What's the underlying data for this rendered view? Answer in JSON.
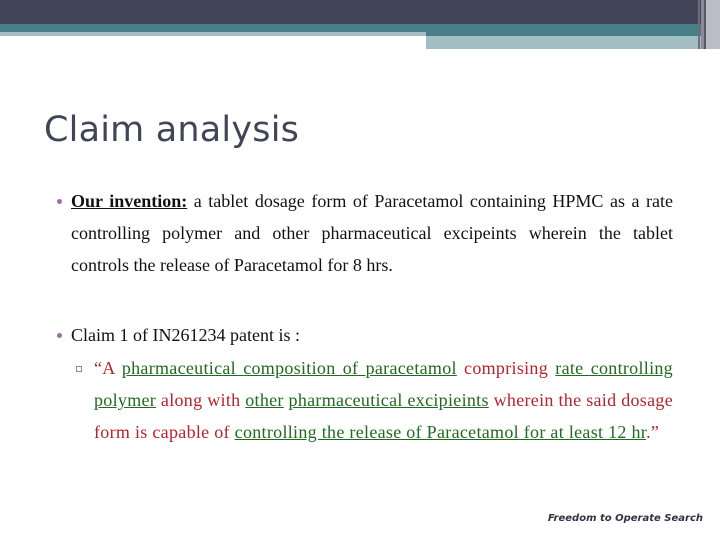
{
  "slide": {
    "title": "Claim analysis",
    "bullets": [
      {
        "label": "Our invention:",
        "text": " a tablet dosage form of Paracetamol containing HPMC as a rate controlling polymer and other pharmaceutical excipeints wherein the tablet controls the release of Paracetamol for 8 hrs."
      },
      {
        "text": "Claim 1 of IN261234 patent is :"
      }
    ],
    "claim_segments": [
      {
        "text": "“A ",
        "style": "red"
      },
      {
        "text": "pharmaceutical ",
        "style": "green"
      },
      {
        "text": " ",
        "style": "red"
      },
      {
        "text": "composition ",
        "style": "green"
      },
      {
        "text": " ",
        "style": "red"
      },
      {
        "text": "of ",
        "style": "green"
      },
      {
        "text": " ",
        "style": "red"
      },
      {
        "text": "paracetamol",
        "style": "green"
      },
      {
        "text": " comprising ",
        "style": "red"
      },
      {
        "text": "rate controlling ",
        "style": "green"
      },
      {
        "text": " ",
        "style": "red"
      },
      {
        "text": "polymer",
        "style": "green"
      },
      {
        "text": " along with ",
        "style": "red"
      },
      {
        "text": "other",
        "style": "green"
      },
      {
        "text": " ",
        "style": "red"
      },
      {
        "text": "pharmaceutical ",
        "style": "green"
      },
      {
        "text": " ",
        "style": "red"
      },
      {
        "text": "excipieints",
        "style": "green"
      },
      {
        "text": " wherein the said dosage form is capable of ",
        "style": "red"
      },
      {
        "text": "controlling the release of Paracetamol for at least 12 hr",
        "style": "green"
      },
      {
        "text": ".”",
        "style": "red"
      }
    ],
    "footer": "Freedom to Operate Search"
  },
  "colors": {
    "header_dark": "#424457",
    "header_teal": "#468086",
    "header_light_teal": "#a3bec3",
    "bullet": "#9b70a8",
    "claim_red": "#b4232a",
    "claim_green": "#1f6a1f"
  }
}
